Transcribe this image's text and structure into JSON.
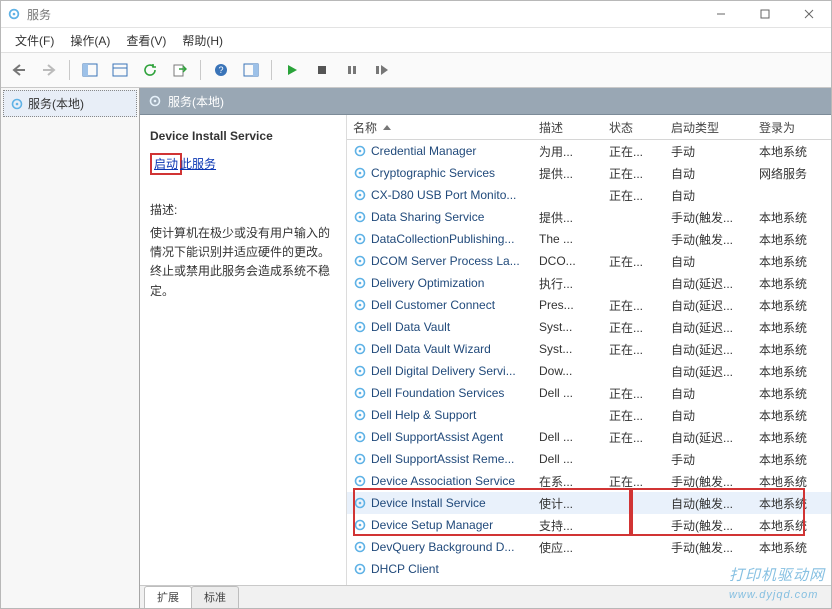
{
  "window": {
    "title": "服务"
  },
  "menubar": [
    "文件(F)",
    "操作(A)",
    "查看(V)",
    "帮助(H)"
  ],
  "nav": {
    "node": "服务(本地)"
  },
  "header": {
    "title": "服务(本地)"
  },
  "detail": {
    "title": "Device Install Service",
    "start_link_left": "启动",
    "start_link_right": "此服务",
    "desc_label": "描述:",
    "desc": "使计算机在极少或没有用户输入的情况下能识别并适应硬件的更改。终止或禁用此服务会造成系统不稳定。"
  },
  "columns": {
    "name": "名称",
    "desc": "描述",
    "status": "状态",
    "start": "启动类型",
    "logon": "登录为"
  },
  "tabs": {
    "ext": "扩展",
    "std": "标准"
  },
  "rows": [
    {
      "name": "Credential Manager",
      "desc": "为用...",
      "status": "正在...",
      "start": "手动",
      "logon": "本地系统"
    },
    {
      "name": "Cryptographic Services",
      "desc": "提供...",
      "status": "正在...",
      "start": "自动",
      "logon": "网络服务"
    },
    {
      "name": "CX-D80 USB Port Monito...",
      "desc": "",
      "status": "正在...",
      "start": "自动",
      "logon": ""
    },
    {
      "name": "Data Sharing Service",
      "desc": "提供...",
      "status": "",
      "start": "手动(触发...",
      "logon": "本地系统"
    },
    {
      "name": "DataCollectionPublishing...",
      "desc": "The ...",
      "status": "",
      "start": "手动(触发...",
      "logon": "本地系统"
    },
    {
      "name": "DCOM Server Process La...",
      "desc": "DCO...",
      "status": "正在...",
      "start": "自动",
      "logon": "本地系统"
    },
    {
      "name": "Delivery Optimization",
      "desc": "执行...",
      "status": "",
      "start": "自动(延迟...",
      "logon": "本地系统"
    },
    {
      "name": "Dell Customer Connect",
      "desc": "Pres...",
      "status": "正在...",
      "start": "自动(延迟...",
      "logon": "本地系统"
    },
    {
      "name": "Dell Data Vault",
      "desc": "Syst...",
      "status": "正在...",
      "start": "自动(延迟...",
      "logon": "本地系统"
    },
    {
      "name": "Dell Data Vault Wizard",
      "desc": "Syst...",
      "status": "正在...",
      "start": "自动(延迟...",
      "logon": "本地系统"
    },
    {
      "name": "Dell Digital Delivery Servi...",
      "desc": "Dow...",
      "status": "",
      "start": "自动(延迟...",
      "logon": "本地系统"
    },
    {
      "name": "Dell Foundation Services",
      "desc": "Dell ...",
      "status": "正在...",
      "start": "自动",
      "logon": "本地系统"
    },
    {
      "name": "Dell Help & Support",
      "desc": "",
      "status": "正在...",
      "start": "自动",
      "logon": "本地系统"
    },
    {
      "name": "Dell SupportAssist Agent",
      "desc": "Dell ...",
      "status": "正在...",
      "start": "自动(延迟...",
      "logon": "本地系统"
    },
    {
      "name": "Dell SupportAssist Reme...",
      "desc": "Dell ...",
      "status": "",
      "start": "手动",
      "logon": "本地系统"
    },
    {
      "name": "Device Association Service",
      "desc": "在系...",
      "status": "正在...",
      "start": "手动(触发...",
      "logon": "本地系统"
    },
    {
      "name": "Device Install Service",
      "desc": "使计...",
      "status": "",
      "start": "自动(触发...",
      "logon": "本地系统",
      "sel": true
    },
    {
      "name": "Device Setup Manager",
      "desc": "支持...",
      "status": "",
      "start": "手动(触发...",
      "logon": "本地系统"
    },
    {
      "name": "DevQuery Background D...",
      "desc": "使应...",
      "status": "",
      "start": "手动(触发...",
      "logon": "本地系统"
    },
    {
      "name": "DHCP Client",
      "desc": "",
      "status": "",
      "start": "",
      "logon": ""
    }
  ],
  "watermark": "打印机驱动网",
  "watermark_url": "www.dyjqd.com"
}
